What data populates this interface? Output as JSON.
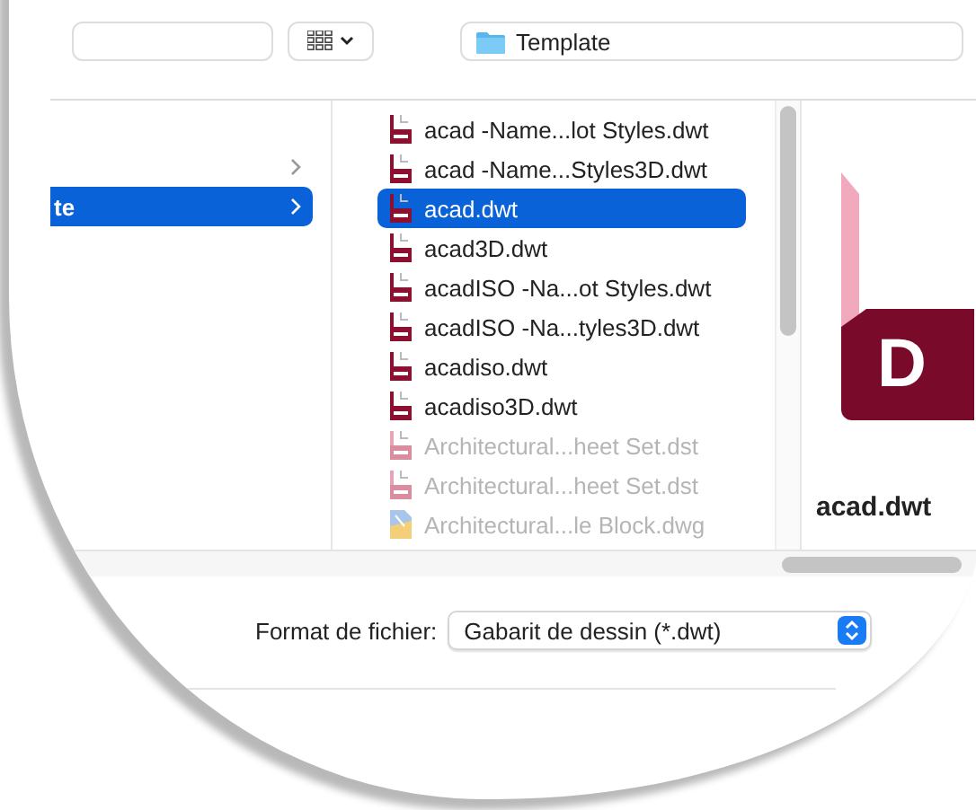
{
  "toolbar": {
    "location": "Template"
  },
  "sidebar": {
    "items": [
      {
        "selected": false
      },
      {
        "label": "te",
        "selected": true
      }
    ]
  },
  "files": [
    {
      "name": "acad -Name...lot Styles.dwt",
      "kind": "dwt",
      "disabled": false,
      "selected": false
    },
    {
      "name": "acad -Name...Styles3D.dwt",
      "kind": "dwt",
      "disabled": false,
      "selected": false
    },
    {
      "name": "acad.dwt",
      "kind": "dwt",
      "disabled": false,
      "selected": true
    },
    {
      "name": "acad3D.dwt",
      "kind": "dwt",
      "disabled": false,
      "selected": false
    },
    {
      "name": "acadISO -Na...ot Styles.dwt",
      "kind": "dwt",
      "disabled": false,
      "selected": false
    },
    {
      "name": "acadISO -Na...tyles3D.dwt",
      "kind": "dwt",
      "disabled": false,
      "selected": false
    },
    {
      "name": "acadiso.dwt",
      "kind": "dwt",
      "disabled": false,
      "selected": false
    },
    {
      "name": "acadiso3D.dwt",
      "kind": "dwt",
      "disabled": false,
      "selected": false
    },
    {
      "name": "Architectural...heet Set.dst",
      "kind": "dst",
      "disabled": true,
      "selected": false
    },
    {
      "name": "Architectural...heet Set.dst",
      "kind": "dst",
      "disabled": true,
      "selected": false
    },
    {
      "name": "Architectural...le Block.dwg",
      "kind": "dwg",
      "disabled": true,
      "selected": false
    }
  ],
  "preview": {
    "icon_letter": "D",
    "name": "acad.dwt"
  },
  "format": {
    "label": "Format de fichier:",
    "value": "Gabarit de dessin (*.dwt)"
  }
}
